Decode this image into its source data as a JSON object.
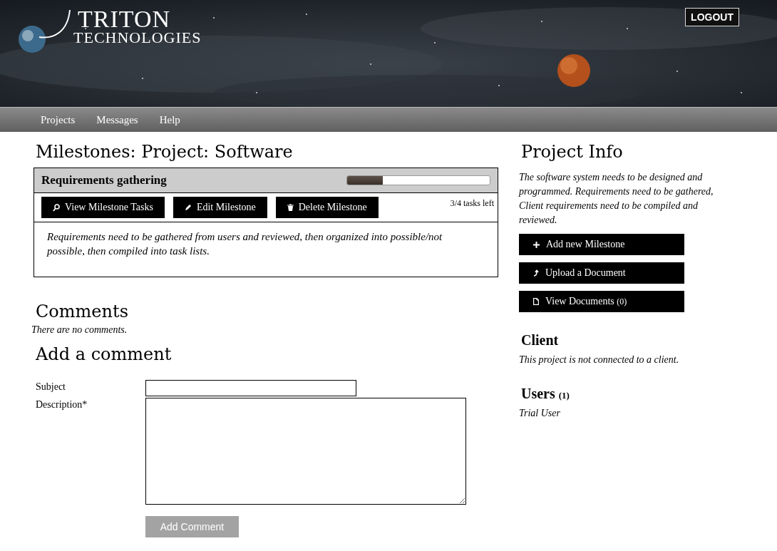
{
  "header": {
    "logo_title": "TRITON",
    "logo_subtitle": "TECHNOLOGIES",
    "logout": "LOGOUT"
  },
  "nav": [
    {
      "label": "Projects"
    },
    {
      "label": "Messages"
    },
    {
      "label": "Help"
    }
  ],
  "page_title": "Milestones: Project: Software",
  "milestones": [
    {
      "title": "Requirements gathering",
      "level": 0.25,
      "tasks_left": "3/4 tasks left",
      "description": "Requirements need to be gathered from users and reviewed, then organized into possible/not possible, then compiled into task lists.",
      "actions": [
        {
          "label": "View Milestone Tasks",
          "kind": "search"
        },
        {
          "label": "Edit Milestone",
          "kind": "pencil"
        },
        {
          "label": "Delete Milestone",
          "kind": "trash"
        }
      ]
    }
  ],
  "comments": {
    "heading": "Comments",
    "empty": "There are no comments."
  },
  "add_comment": {
    "heading": "Add a comment",
    "fields": [
      {
        "label": "Subject",
        "kind": "text"
      },
      {
        "label": "Description*",
        "kind": "textarea"
      }
    ],
    "submit": "Add Comment"
  },
  "project_info": {
    "heading": "Project Info",
    "description": "The software system needs to be designed and programmed. Requirements need to be gathered, Client requirements need to be compiled and reviewed.",
    "actions": [
      {
        "label": "Add new Milestone",
        "kind": "plus"
      },
      {
        "label": "Upload a Document",
        "kind": "upload"
      },
      {
        "label": "View Documents",
        "count": "(0)",
        "kind": "document"
      }
    ]
  },
  "client": {
    "heading": "Client",
    "text": "This project is not connected to a client."
  },
  "users": {
    "heading": "Users",
    "count": "(1)",
    "items": [
      "Trial User"
    ]
  }
}
